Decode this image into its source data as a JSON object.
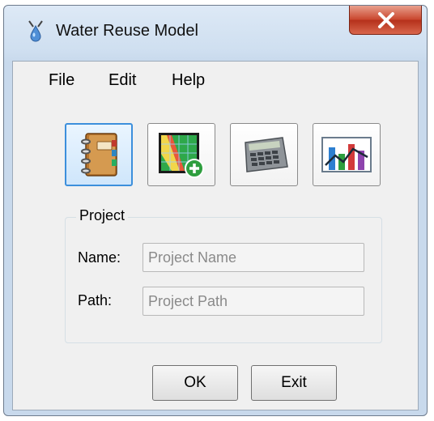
{
  "window": {
    "title": "Water Reuse Model"
  },
  "menu": {
    "items": [
      "File",
      "Edit",
      "Help"
    ]
  },
  "toolbar": {
    "buttons": [
      {
        "name": "project-notebook",
        "icon": "notebook-icon"
      },
      {
        "name": "add-map-layer",
        "icon": "map-add-icon"
      },
      {
        "name": "calculator",
        "icon": "calculator-icon"
      },
      {
        "name": "chart-results",
        "icon": "chart-icon"
      }
    ]
  },
  "project": {
    "group_label": "Project",
    "name_label": "Name:",
    "name_placeholder": "Project Name",
    "name_value": "",
    "path_label": "Path:",
    "path_placeholder": "Project Path",
    "path_value": ""
  },
  "buttons": {
    "ok": "OK",
    "exit": "Exit"
  },
  "colors": {
    "close_button": "#c9452c",
    "active_tool_border": "#3c8fdc",
    "client_bg": "#f0f0f0"
  }
}
